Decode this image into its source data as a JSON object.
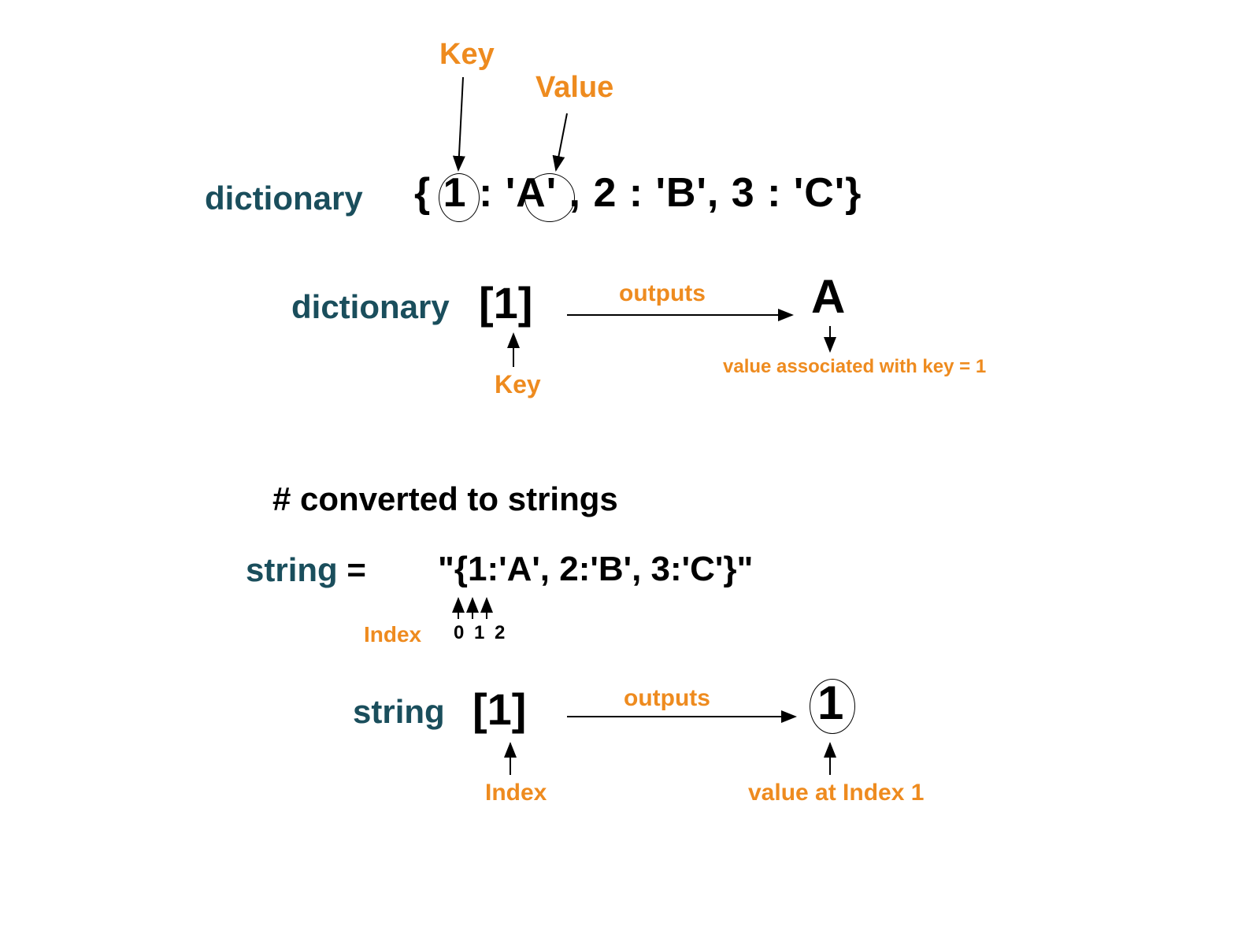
{
  "labels": {
    "key_top": "Key",
    "value_top": "Value",
    "dictionary": "dictionary",
    "dict_literal": "{  1  : 'A' , 2 : 'B', 3 : 'C'}",
    "dict_bracket": "[1]",
    "outputs": "outputs",
    "result_a": "A",
    "key_bot": "Key",
    "value_assoc": "value associated with key = 1",
    "comment": "# converted to strings",
    "string": "string",
    "equals": " = ",
    "string_literal": "\"{1:'A', 2:'B', 3:'C'}\"",
    "index": "Index",
    "index_numbers": "0 1 2",
    "result_1": "1",
    "value_at_index": "value at Index  1"
  },
  "diagram_data": {
    "dictionary": {
      "1": "A",
      "2": "B",
      "3": "C"
    },
    "dict_lookup_key": 1,
    "dict_lookup_result": "A",
    "string_value": "{1:'A', 2:'B', 3:'C'}",
    "string_index_shown": [
      0,
      1,
      2
    ],
    "string_lookup_index": 1,
    "string_lookup_result": "1"
  }
}
